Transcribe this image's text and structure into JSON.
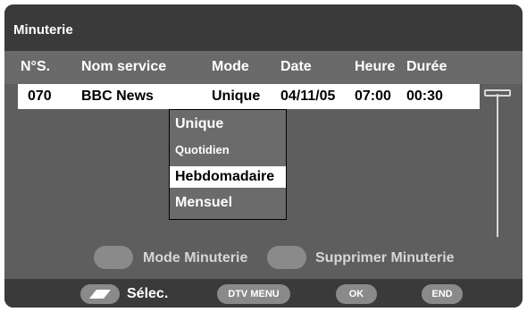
{
  "window": {
    "title": "Minuterie"
  },
  "table": {
    "headers": [
      "N°S.",
      "Nom service",
      "Mode",
      "Date",
      "Heure",
      "Durée"
    ],
    "rows": [
      [
        "070",
        "BBC News",
        "Unique",
        "04/11/05",
        "07:00",
        "00:30"
      ]
    ]
  },
  "mode_dropdown": {
    "options": [
      "Unique",
      "Quotidien",
      "Hebdomadaire",
      "Mensuel"
    ],
    "selected": "Hebdomadaire"
  },
  "legend": {
    "mode_timer": "Mode Minuterie",
    "delete_timer": "Supprimer Minuterie"
  },
  "bottom_bar": {
    "select_label": "Sélec.",
    "dtv_menu": "DTV MENU",
    "ok": "OK",
    "end": "END"
  },
  "colors": {
    "panel": "#5e5e5e",
    "title_bar": "#3a3a3a",
    "header_row": "#6a6a6a",
    "highlight": "#ffffff",
    "button_gray": "#8a8a8a"
  },
  "icons": {
    "select": "up-down-arrows-icon",
    "scroll": "scrollbar-thumb-icon"
  }
}
